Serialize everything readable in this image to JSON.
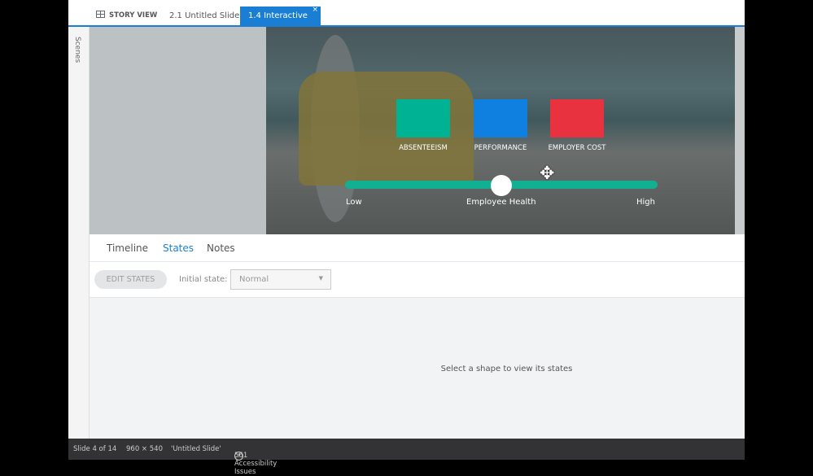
{
  "tabs": {
    "story_view": "STORY VIEW",
    "slide_tab": "2.1 Untitled Slide",
    "active_tab": "1.4 Interactive ...",
    "close": "×"
  },
  "sidebar": {
    "scenes": "Scenes"
  },
  "slide": {
    "boxes": [
      {
        "label": "ABSENTEEISM",
        "color": "#00b294"
      },
      {
        "label": "PERFORMANCE",
        "color": "#0f7fe0"
      },
      {
        "label": "EMPLOYER COST",
        "color": "#e8323f"
      }
    ],
    "slider": {
      "low": "Low",
      "mid": "Employee Health",
      "high": "High",
      "value_percent": 50,
      "color": "#12b093"
    }
  },
  "panel": {
    "tabs": [
      "Timeline",
      "States",
      "Notes"
    ],
    "active_tab": "States",
    "edit_states": "EDIT STATES",
    "initial_state_label": "Initial state:",
    "initial_state_value": "Normal",
    "empty_message": "Select a shape to view its states"
  },
  "status": {
    "slide": "Slide 4 of 14",
    "size": "960 × 540",
    "title": "'Untitled Slide'",
    "issues": "561 Accessibility Issues"
  }
}
